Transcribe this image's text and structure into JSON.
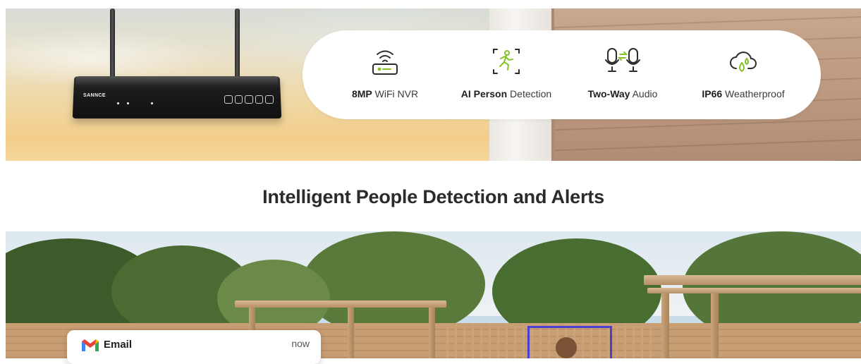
{
  "hero": {
    "device_brand": "SANNCE",
    "features": [
      {
        "icon": "wifi-router-icon",
        "bold": "8MP",
        "text": " WiFi NVR"
      },
      {
        "icon": "person-detection-icon",
        "bold": "AI Person",
        "text": " Detection"
      },
      {
        "icon": "two-way-audio-icon",
        "bold": "Two-Way",
        "text": " Audio"
      },
      {
        "icon": "weatherproof-cloud-icon",
        "bold": "IP66",
        "text": " Weatherproof"
      }
    ],
    "accent_color": "#86c226"
  },
  "section": {
    "heading": "Intelligent People Detection and Alerts"
  },
  "notification": {
    "app_icon": "gmail-icon",
    "title": "Email",
    "time": "now"
  },
  "colors": {
    "heading_text": "#2b2b2b",
    "detection_box": "#4a3fd0"
  }
}
